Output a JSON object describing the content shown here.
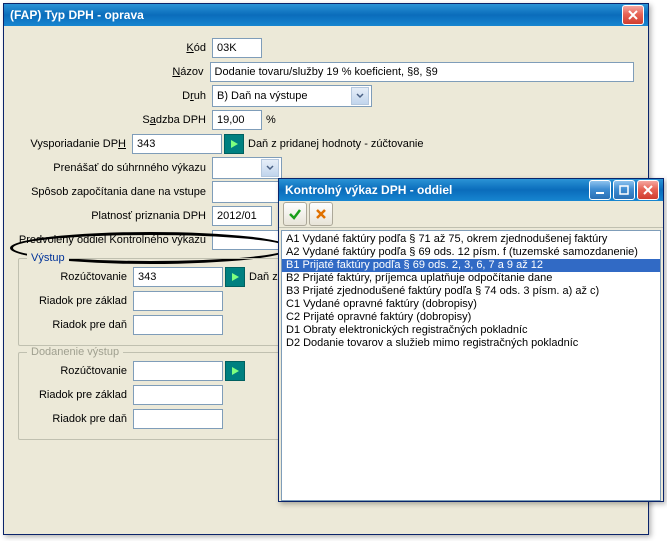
{
  "main_window": {
    "title": "(FAP) Typ DPH - oprava",
    "fields": {
      "kod_label": "Kód",
      "kod_value": "03K",
      "nazov_label": "Názov",
      "nazov_value": "Dodanie tovaru/služby 19 % koeficient, §8, §9",
      "druh_label": "Druh",
      "druh_value": "B) Daň na výstupe",
      "sadzba_label": "Sadzba DPH",
      "sadzba_value": "19,00",
      "sadzba_suffix": "%",
      "vysporiadanie_label": "Vysporiadanie DPH",
      "vysporiadanie_value": "343",
      "vysporiadanie_trail": "Daň z pridanej hodnoty - zúčtovanie",
      "prenasat_label": "Prenášať do súhrnného výkazu",
      "sposob_label": "Spôsob započítania dane na vstupe",
      "platnost_label": "Platnosť priznania DPH",
      "platnost_value": "2012/01",
      "predvoleny_label": "Predvolený oddiel Kontrolného výkazu"
    },
    "vystup": {
      "title": "Výstup",
      "rozuctovanie_label": "Rozúčtovanie",
      "rozuctovanie_value": "343",
      "rozuctovanie_trail": "Daň z p",
      "riadok_zaklad_label": "Riadok pre základ",
      "riadok_dan_label": "Riadok pre daň"
    },
    "dodanenie": {
      "title": "Dodanenie výstup",
      "rozuctovanie_label": "Rozúčtovanie",
      "riadok_zaklad_label": "Riadok pre základ",
      "riadok_dan_label": "Riadok pre daň"
    }
  },
  "popup": {
    "title": "Kontrolný výkaz DPH - oddiel",
    "items": [
      "A1 Vydané faktúry podľa § 71 až 75, okrem zjednodušenej faktúry",
      "A2 Vydané faktúry podľa § 69 ods. 12 písm. f (tuzemské samozdanenie)",
      "B1 Prijaté faktúry podľa § 69 ods. 2, 3, 6, 7 a 9 až 12",
      "B2 Prijaté faktúry, príjemca uplatňuje odpočítanie dane",
      "B3 Prijaté zjednodušené faktúry podľa § 74 ods. 3 písm. a) až c)",
      "C1 Vydané opravné faktúry (dobropisy)",
      "C2 Prijaté opravné faktúry (dobropisy)",
      "D1 Obraty elektronických registračných pokladníc",
      "D2 Dodanie tovarov a služieb mimo registračných pokladníc"
    ],
    "selected_index": 2
  }
}
